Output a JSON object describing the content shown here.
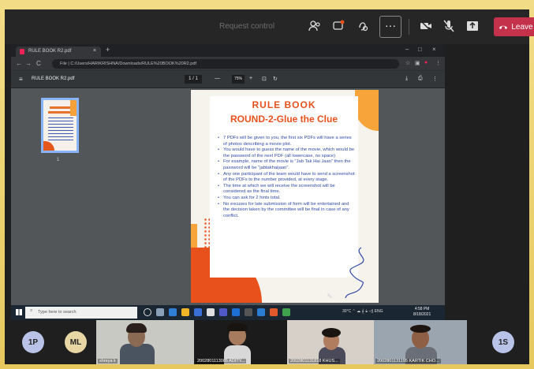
{
  "meeting": {
    "request_control": "Request control",
    "leave_label": "Leave",
    "more_label": "···",
    "accent_leave": "#c4314b",
    "icons": [
      "people-icon",
      "chat-icon",
      "reactions-icon",
      "more-icon",
      "camera-off-icon",
      "mic-off-icon",
      "share-icon",
      "phone-icon"
    ]
  },
  "browser": {
    "tab_title": "RULE BOOK R2.pdf",
    "tab_close": "×",
    "new_tab": "+",
    "minimize": "–",
    "maximize": "□",
    "close": "×",
    "back": "←",
    "forward": "→",
    "reload": "C",
    "address": "File  |  C:/Users/HARIKRISHNA/Downloads/RULE%20BOOK%20R2.pdf",
    "menu": "⋮"
  },
  "pdf_toolbar": {
    "menu": "≡",
    "file_name": "RULE BOOK R2.pdf",
    "page_current": "1 / 1",
    "zoom_out": "—",
    "zoom_value": "75%",
    "zoom_in": "+",
    "fit": "⊡",
    "rotate": "↻",
    "download": "⤓",
    "print": "⎙",
    "more": "⋮"
  },
  "thumbnail_page_number": "1",
  "document": {
    "title": "RULE BOOK",
    "subtitle": "ROUND-2-Glue the Clue",
    "rules": [
      "7 PDFs will be given to you, the first six PDFs will have a series of photos describing a movie plot.",
      "You would have to guess the name of the movie, which would be the password of the next PDF (all lowercase, no space)",
      "For example, name of the movie is \"Jab Tak Hai Jaan\" then the password will be \"jabtakhaijaan\".",
      "Any one participant of the team would have to send a screenshot of the PDFs to the number provided, at every stage.",
      "The time at which we will receive the screenshot will be considered as the final time.",
      "You can ask for 2 hints total.",
      "No excuses for late submission of form will be entertained and the decision taken by the committee will be final in case of any conflict."
    ],
    "accent_orange": "#e8501c",
    "accent_yellow": "#f7a43a",
    "text_blue": "#2f4aa8"
  },
  "taskbar": {
    "search_placeholder": "Type here to search",
    "tray_text": "30°C  ⌃ ☁ 𝄞 ⏚ ◁)  ENG",
    "time": "4:58 PM",
    "date": "8/18/2021"
  },
  "participants": [
    {
      "initials": "1P",
      "color": "#b9c3e8"
    },
    {
      "initials": "ML",
      "color": "#e8d6a4"
    },
    {
      "name": "shreya k"
    },
    {
      "name": "2002801113085 ADITY..."
    },
    {
      "name": "2002801131818 KHUS..."
    },
    {
      "name": "2002801131195 KARTIK CHO..."
    },
    {
      "initials": "1S",
      "color": "#b9c3e8"
    }
  ]
}
